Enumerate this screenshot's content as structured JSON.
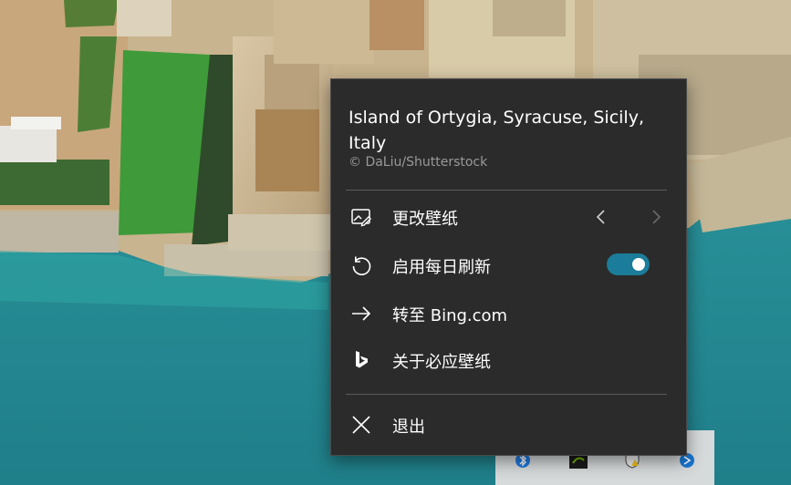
{
  "wallpaper": {
    "title": "Island of Ortygia, Syracuse, Sicily, Italy",
    "credit": "© DaLiu/Shutterstock"
  },
  "menu": {
    "items": [
      {
        "label": "更改壁纸",
        "icon": "image-edit-icon"
      },
      {
        "label": "启用每日刷新",
        "icon": "refresh-icon",
        "toggle_on": true
      },
      {
        "label": "转至 Bing.com",
        "icon": "arrow-right-icon"
      },
      {
        "label": "关于必应壁纸",
        "icon": "bing-logo-icon"
      },
      {
        "label": "退出",
        "icon": "close-icon"
      }
    ],
    "prev_icon": "chevron-left-icon",
    "next_icon": "chevron-right-icon"
  },
  "colors": {
    "menu_bg": "#2b2b2b",
    "toggle_on": "#1b7d99",
    "credit_text": "#9a9a9a",
    "sea": "#2b8c93"
  },
  "tray": {
    "icons": [
      "bluetooth-icon",
      "nvidia-icon",
      "security-warning-icon",
      "bing-tray-icon"
    ]
  }
}
